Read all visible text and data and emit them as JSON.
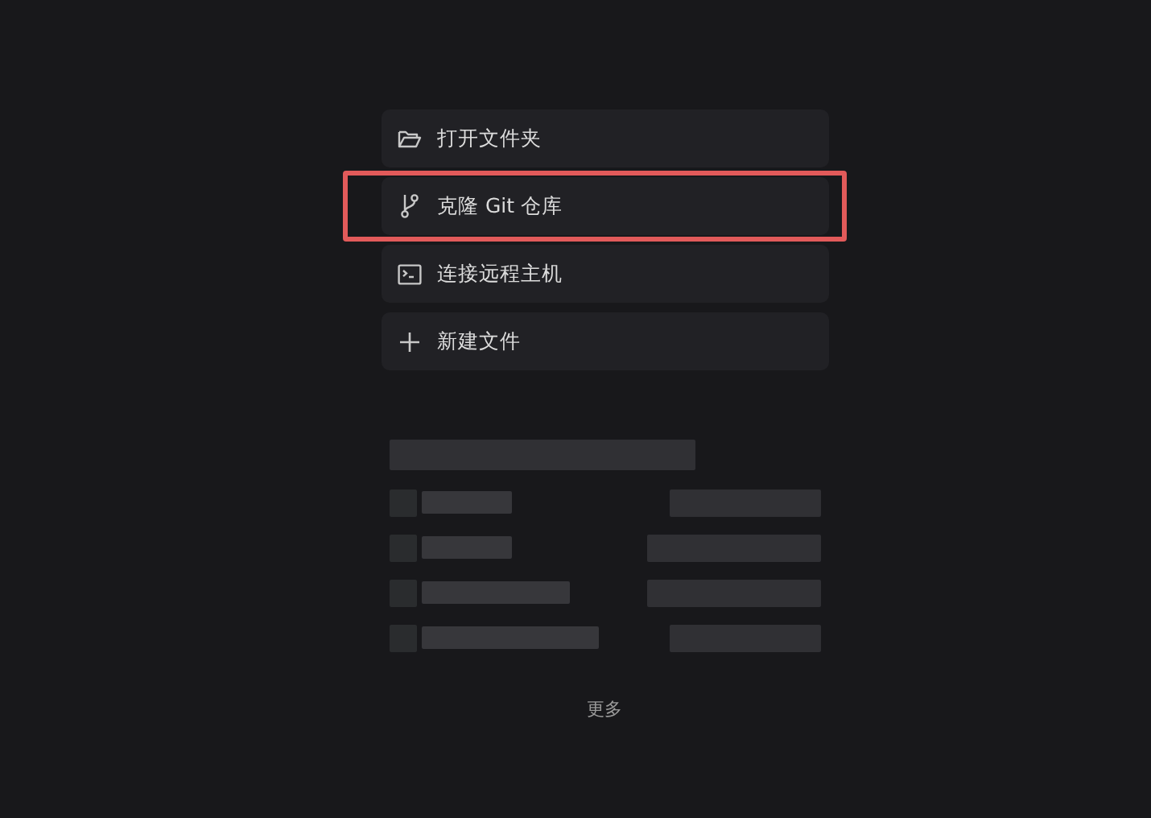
{
  "actions": [
    {
      "kind": "folder",
      "label": "打开文件夹",
      "highlighted": false
    },
    {
      "kind": "branch",
      "label": "克隆 Git 仓库",
      "highlighted": true
    },
    {
      "kind": "terminal",
      "label": "连接远程主机",
      "highlighted": false
    },
    {
      "kind": "plus",
      "label": "新建文件",
      "highlighted": false
    }
  ],
  "recent_projects": {
    "header": {
      "kind": "redacted"
    },
    "rows": [
      {
        "kind": "redacted"
      },
      {
        "kind": "redacted"
      },
      {
        "kind": "redacted"
      },
      {
        "kind": "redacted"
      }
    ]
  },
  "more_link": "更多"
}
